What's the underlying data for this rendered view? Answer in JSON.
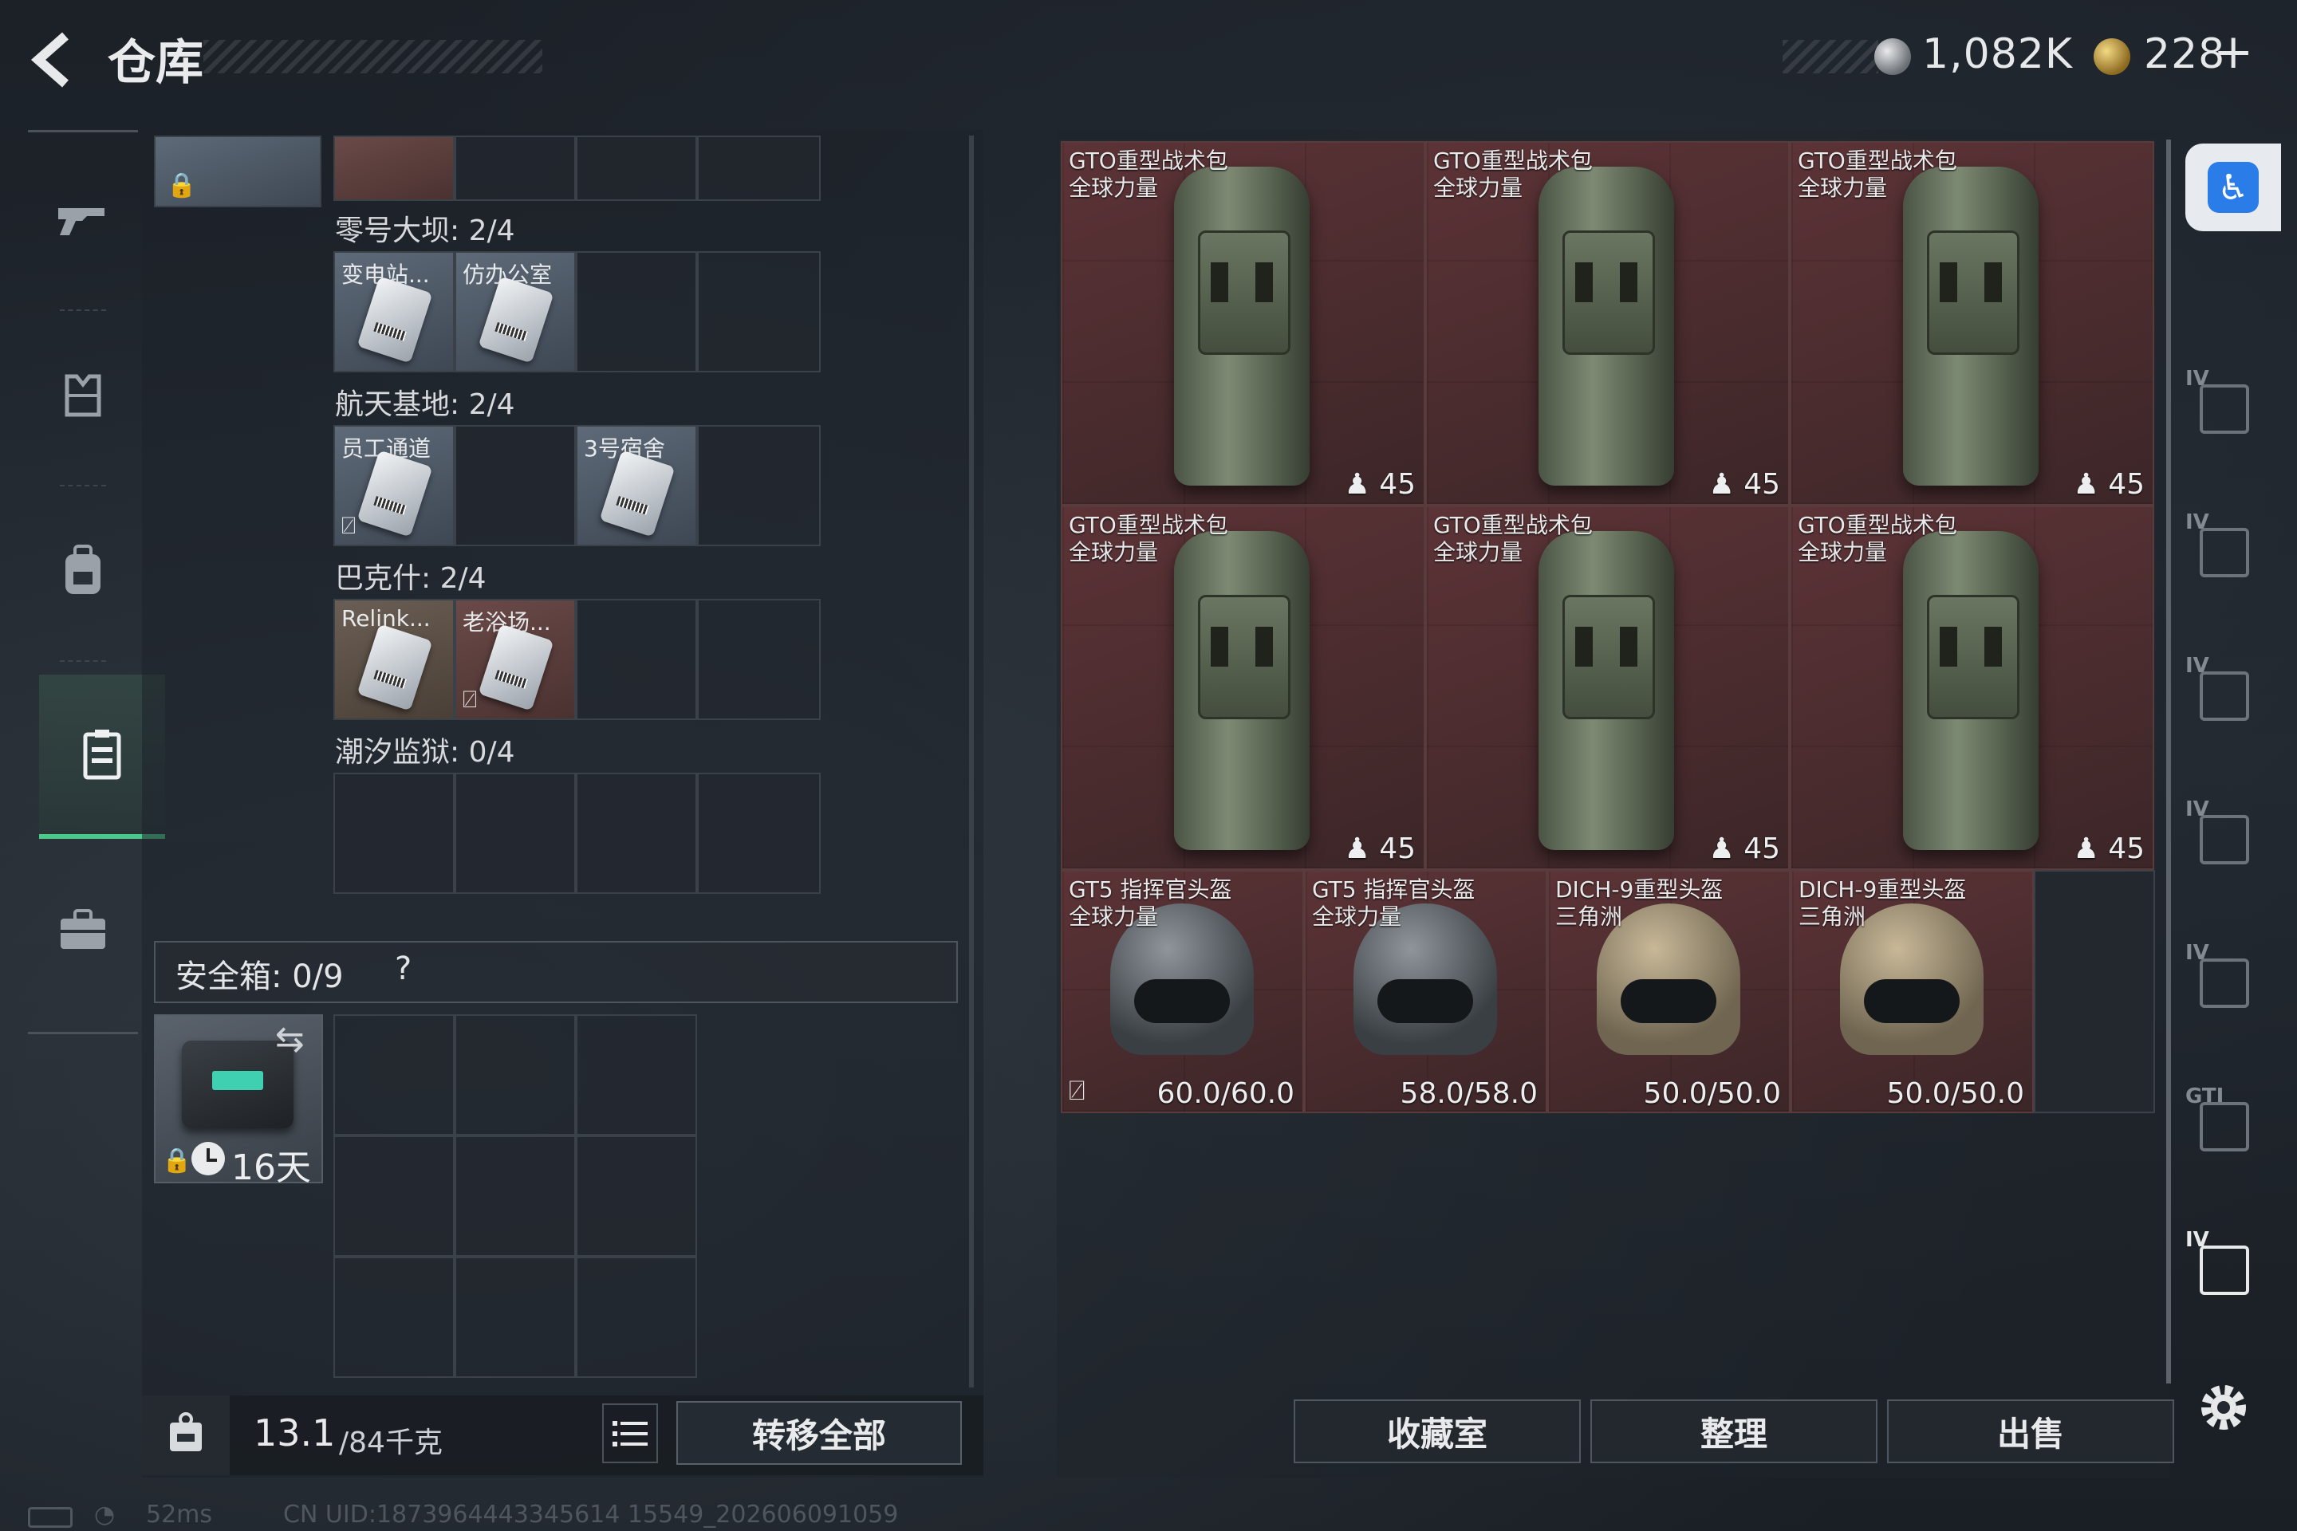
{
  "header": {
    "title": "仓库",
    "currencies": [
      {
        "icon": "silver-coin-icon",
        "value": "1,082K"
      },
      {
        "icon": "gold-coin-icon",
        "value": "228"
      }
    ],
    "add_label": "+"
  },
  "nav": {
    "items": [
      "gun-icon",
      "armor-icon",
      "backpack-icon",
      "keycard-case-icon",
      "briefcase-icon"
    ],
    "active": "keycard-case-icon"
  },
  "keycard_groups": [
    {
      "label": "零号大坝: 2/4",
      "slots": [
        "变电站...",
        "仿办公室",
        "",
        ""
      ]
    },
    {
      "label": "航天基地: 2/4",
      "slots": [
        "员工通道",
        "",
        "3号宿舍",
        ""
      ]
    },
    {
      "label": "巴克什: 2/4",
      "slots": [
        "Relink...",
        "老浴场...",
        "",
        ""
      ]
    },
    {
      "label": "潮汐监狱: 0/4",
      "slots": [
        "",
        "",
        "",
        ""
      ]
    }
  ],
  "safebox": {
    "title": "安全箱:  0/9",
    "help": "?",
    "days": "16天"
  },
  "footer": {
    "weight_value": "13.1",
    "weight_unit": "/84千克",
    "transfer_all": "转移全部"
  },
  "items": [
    {
      "name1": "GTO重型战术包",
      "name2": "全球力量",
      "capacity": "45"
    },
    {
      "name1": "GTO重型战术包",
      "name2": "全球力量",
      "capacity": "45"
    },
    {
      "name1": "GTO重型战术包",
      "name2": "全球力量",
      "capacity": "45"
    },
    {
      "name1": "GTO重型战术包",
      "name2": "全球力量",
      "capacity": "45"
    },
    {
      "name1": "GTO重型战术包",
      "name2": "全球力量",
      "capacity": "45"
    },
    {
      "name1": "GTO重型战术包",
      "name2": "全球力量",
      "capacity": "45"
    }
  ],
  "helmets": [
    {
      "name1": "GT5 指挥官头盔",
      "name2": "全球力量",
      "durability": "60.0/60.0"
    },
    {
      "name1": "GT5 指挥官头盔",
      "name2": "全球力量",
      "durability": "58.0/58.0"
    },
    {
      "name1": "DICH-9重型头盔",
      "name2": "三角洲",
      "durability": "50.0/50.0"
    },
    {
      "name1": "DICH-9重型头盔",
      "name2": "三角洲",
      "durability": "50.0/50.0"
    }
  ],
  "actions": {
    "collection": "收藏室",
    "organize": "整理",
    "sell": "出售"
  },
  "side_tabs": [
    "IV",
    "IV",
    "IV",
    "IV",
    "IV",
    "GTI",
    "IV"
  ],
  "status": {
    "ping": "52ms",
    "uid": "CN UID:1873964443345614 15549_202606091059"
  },
  "colors": {
    "accent_green": "#49c98a",
    "item_bg_red": "#5c3336",
    "accessibility_blue": "#2a7ce8"
  }
}
